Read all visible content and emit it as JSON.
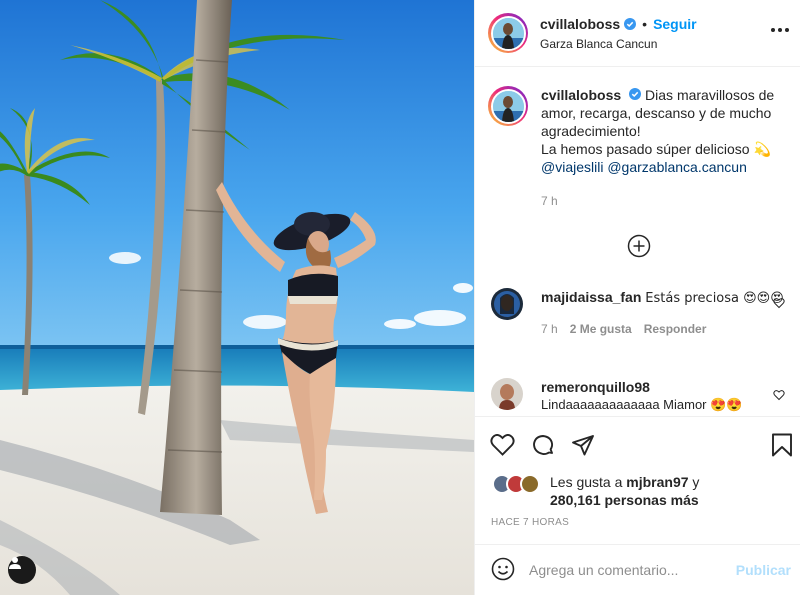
{
  "post": {
    "username": "cvillaloboss",
    "follow_label": "Seguir",
    "separator": "•",
    "location": "Garza Blanca Cancun",
    "more_icon": "more-options-icon"
  },
  "caption": {
    "username": "cvillaloboss",
    "text_line1": "Dias maravillosos de amor, recarga, descanso y de mucho agradecimiento!",
    "text_line2": "La hemos pasado súper delicioso 💫",
    "mention1": "@viajeslili",
    "mention2": "@garzablanca.cancun",
    "time": "7 h"
  },
  "load_more_icon": "plus-circle-icon",
  "comments": [
    {
      "username": "majidaissa_fan",
      "text": "Estás preciosa 😍😍😍",
      "time": "7 h",
      "likes": "2 Me gusta",
      "reply": "Responder"
    },
    {
      "username": "remeronquillo98",
      "text": "Lindaaaaaaaaaaaaa Miamor 😍😍"
    }
  ],
  "likes": {
    "prefix": "Les gusta a",
    "user": "mjbran97",
    "joiner": "y",
    "count_text": "280,161 personas más"
  },
  "time_ago": "HACE 7 HORAS",
  "add_comment": {
    "placeholder": "Agrega un comentario...",
    "publish_label": "Publicar"
  },
  "colors": {
    "accent": "#0095f6",
    "publish_disabled": "#b2dffc",
    "muted": "#8e8e8e",
    "text": "#262626",
    "mention": "#00376b"
  }
}
